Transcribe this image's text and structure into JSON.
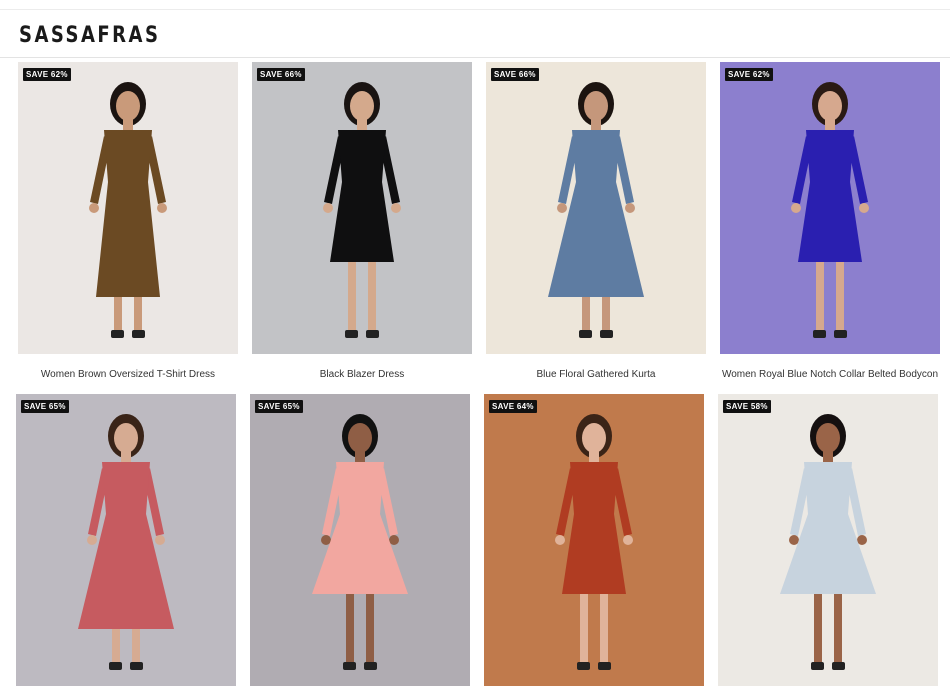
{
  "brand": {
    "logo_text": "SASSAFRAS"
  },
  "products": [
    {
      "badge": "SAVE 62%",
      "title": "Women Brown Oversized T-Shirt Dress",
      "bg": "#ebe7e4",
      "dress": "#6b4a23",
      "skin": "#c99a7a",
      "hair": "#1b1411",
      "image": "brown-tshirt-dress-photo"
    },
    {
      "badge": "SAVE 66%",
      "title": "Black Blazer Dress",
      "bg": "#c2c3c6",
      "dress": "#0f0f10",
      "skin": "#d4a98c",
      "hair": "#1a1412",
      "image": "black-blazer-dress-photo"
    },
    {
      "badge": "SAVE 66%",
      "title": "Blue Floral Gathered Kurta",
      "bg": "#ede6da",
      "dress": "#5e7ca2",
      "skin": "#c5977b",
      "hair": "#1c1410",
      "image": "blue-floral-kurta-photo"
    },
    {
      "badge": "SAVE 62%",
      "title": "Women Royal Blue Notch Collar Belted Bodycon",
      "bg": "#8c7fce",
      "dress": "#2a1fb0",
      "skin": "#d6a88e",
      "hair": "#2a1a14",
      "image": "royal-blue-bodycon-photo"
    },
    {
      "badge": "SAVE 65%",
      "title": "",
      "bg": "#bdbac1",
      "dress": "#c65b60",
      "skin": "#d6ab92",
      "hair": "#3a2418",
      "image": "pink-maxi-dress-photo"
    },
    {
      "badge": "SAVE 65%",
      "title": "",
      "bg": "#b0acb2",
      "dress": "#f2a7a0",
      "skin": "#8f5e45",
      "hair": "#111111",
      "image": "peach-puff-sleeve-dress-photo"
    },
    {
      "badge": "SAVE 64%",
      "title": "",
      "bg": "#c07a4c",
      "dress": "#b03c22",
      "skin": "#e0b39a",
      "hair": "#3b2417",
      "image": "rust-wrap-dress-photo"
    },
    {
      "badge": "SAVE 58%",
      "title": "",
      "bg": "#ece9e4",
      "dress": "#c7d3de",
      "skin": "#9a6448",
      "hair": "#151010",
      "image": "floral-print-dress-photo"
    }
  ]
}
